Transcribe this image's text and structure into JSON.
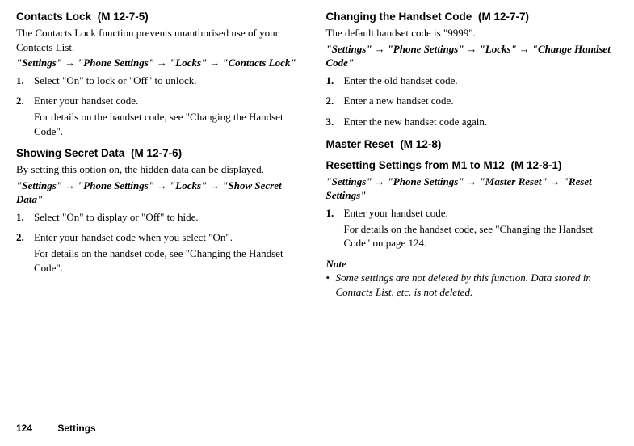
{
  "left": {
    "sec1": {
      "heading": "Contacts Lock",
      "menucode": "(M 12-7-5)",
      "intro": "The Contacts Lock function prevents unauthorised use of your Contacts List.",
      "path": [
        "\"Settings\"",
        "\"Phone Settings\"",
        "\"Locks\"",
        "\"Contacts Lock\""
      ],
      "steps": [
        {
          "n": "1.",
          "lines": [
            "Select \"On\" to lock or \"Off\" to unlock."
          ]
        },
        {
          "n": "2.",
          "lines": [
            "Enter your handset code.",
            "For details on the handset code, see \"Changing the Handset Code\"."
          ]
        }
      ]
    },
    "sec2": {
      "heading": "Showing Secret Data",
      "menucode": "(M 12-7-6)",
      "intro": "By setting this option on, the hidden data can be displayed.",
      "path": [
        "\"Settings\"",
        "\"Phone Settings\"",
        "\"Locks\"",
        "\"Show Secret Data\""
      ],
      "steps": [
        {
          "n": "1.",
          "lines": [
            "Select \"On\" to display or \"Off\" to hide."
          ]
        },
        {
          "n": "2.",
          "lines": [
            "Enter your handset code when you select \"On\".",
            "For details on the handset code, see \"Changing the Handset Code\"."
          ]
        }
      ]
    }
  },
  "right": {
    "sec1": {
      "heading": "Changing the Handset Code",
      "menucode": "(M 12-7-7)",
      "intro": "The default handset code is \"9999\".",
      "path": [
        "\"Settings\"",
        "\"Phone Settings\"",
        "\"Locks\"",
        "\"Change Handset Code\""
      ],
      "steps": [
        {
          "n": "1.",
          "lines": [
            "Enter the old handset code."
          ]
        },
        {
          "n": "2.",
          "lines": [
            "Enter a new handset code."
          ]
        },
        {
          "n": "3.",
          "lines": [
            "Enter the new handset code again."
          ]
        }
      ]
    },
    "sec2": {
      "heading": "Master Reset",
      "menucode": "(M 12-8)"
    },
    "sec3": {
      "heading": "Resetting Settings from M1 to M12",
      "menucode": "(M 12-8-1)",
      "path": [
        "\"Settings\"",
        "\"Phone Settings\"",
        "\"Master Reset\"",
        "\"Reset Settings\""
      ],
      "steps": [
        {
          "n": "1.",
          "lines": [
            "Enter your handset code.",
            "For details on the handset code, see \"Changing the Handset Code\" on page 124."
          ]
        }
      ],
      "noteLabel": "Note",
      "noteBullet": "•",
      "noteText": "Some settings are not deleted by this function. Data stored in Contacts List, etc. is not deleted."
    }
  },
  "footer": {
    "page": "124",
    "section": "Settings"
  },
  "arrow": "→"
}
